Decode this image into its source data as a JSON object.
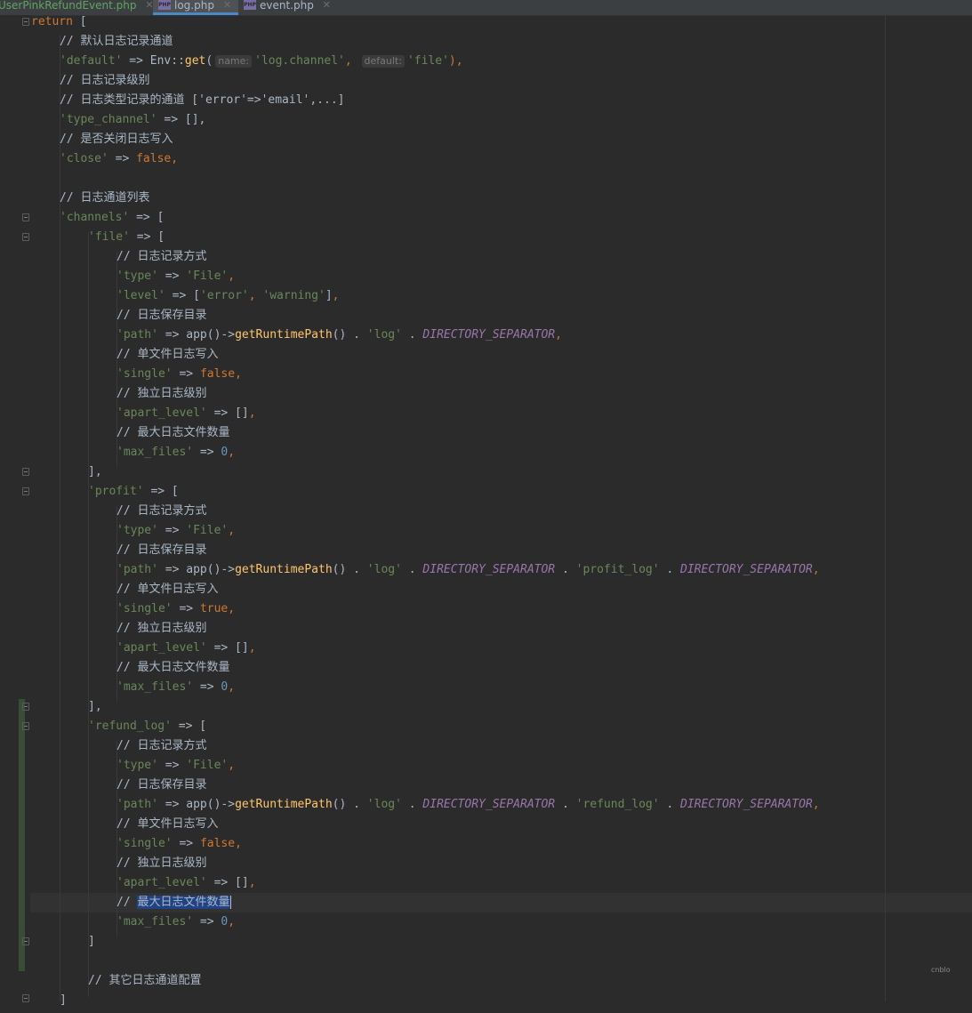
{
  "tabs": [
    {
      "label": "UserPinkRefundEvent.php",
      "active": false
    },
    {
      "label": "log.php",
      "active": true,
      "icon": "php"
    },
    {
      "label": "event.php",
      "active": false,
      "icon": "php"
    }
  ],
  "close_glyph": "✕",
  "hints": {
    "name": "name:",
    "default": "default:"
  },
  "code": {
    "l1_kw": "return",
    "l1_rest": " [",
    "l2": "// 默认日志记录通道",
    "l3_key": "'default'",
    "l3_arrow": " => Env::",
    "l3_fn": "get",
    "l3_paren": "(",
    "l3_arg1": "'log.channel'",
    "l3_comma": ", ",
    "l3_arg2": "'file'",
    "l3_end": "),",
    "l4": "// 日志记录级别",
    "l5": "// 日志类型记录的通道 ['error'=>'email',...]",
    "l6_key": "'type_channel'",
    "l6_rest": " => [],",
    "l7": "// 是否关闭日志写入",
    "l8_key": "'close'",
    "l8_arrow": " => ",
    "l8_val": "false",
    "l8_comma": ",",
    "l10": "// 日志通道列表",
    "l11_key": "'channels'",
    "l11_rest": " => [",
    "l12_key": "'file'",
    "l12_rest": " => [",
    "c_method": "// 日志记录方式",
    "k_type": "'type'",
    "v_type": "'File'",
    "k_level": "'level'",
    "v_error": "'error'",
    "v_warning": "'warning'",
    "c_dir": "// 日志保存目录",
    "k_path": "'path'",
    "app_call": "app()->",
    "fn_runtime": "getRuntimePath",
    "v_log": "'log'",
    "ds": "DIRECTORY_SEPARATOR",
    "c_single": "// 单文件日志写入",
    "k_single": "'single'",
    "v_false": "false",
    "v_true": "true",
    "c_apart": "// 独立日志级别",
    "k_apart": "'apart_level'",
    "c_max": "// 最大日志文件数量",
    "c_max_prefix": "// ",
    "c_max_text": "最大日志文件数量",
    "k_max": "'max_files'",
    "v_zero": "0",
    "close_bracket_comma": "],",
    "close_bracket": "]",
    "k_profit": "'profit'",
    "v_profit_log": "'profit_log'",
    "k_refund": "'refund_log'",
    "v_refund_log": "'refund_log'",
    "c_other": "// 其它日志通道配置",
    "last": "]"
  },
  "watermark": "cnblo"
}
